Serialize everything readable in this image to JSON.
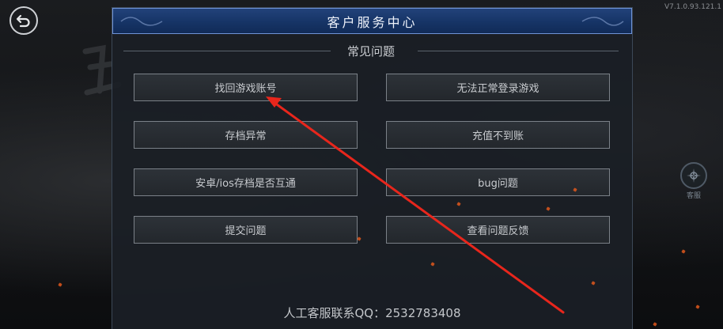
{
  "version": "V7.1.0.93.121.1",
  "back_button": {
    "icon": "back-arrow-icon"
  },
  "customer_service_button": {
    "label": "客服",
    "icon": "compass-badge-icon"
  },
  "dialog": {
    "title": "客户服务中心",
    "section_title": "常见问题",
    "buttons": [
      {
        "label": "找回游戏账号"
      },
      {
        "label": "无法正常登录游戏"
      },
      {
        "label": "存档异常"
      },
      {
        "label": "充值不到账"
      },
      {
        "label": "安卓/ios存档是否互通"
      },
      {
        "label": "bug问题"
      },
      {
        "label": "提交问题"
      },
      {
        "label": "查看问题反馈"
      }
    ],
    "contact_text": "人工客服联系QQ：2532783408"
  },
  "annotation": {
    "type": "arrow",
    "color": "#e8261c"
  }
}
